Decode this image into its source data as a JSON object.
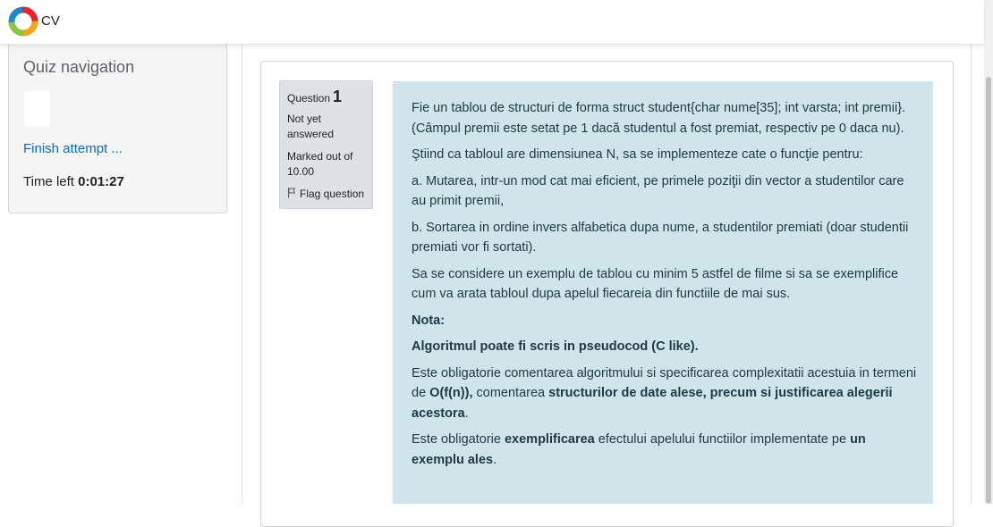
{
  "navbar": {
    "brand": "CV",
    "logo_icon": "ring-logo-icon"
  },
  "quiz_navigation": {
    "title": "Quiz navigation",
    "finish_label": "Finish attempt ...",
    "time_left_label": "Time left",
    "time_left_value": "0:01:27"
  },
  "question": {
    "label": "Question",
    "number": "1",
    "state": "Not yet answered",
    "grade": "Marked out of 10.00",
    "flag_label": "Flag question"
  },
  "question_text": {
    "p1": "Fie un tablou de structuri de forma struct student{char nume[35]; int varsta; int premii}. (Câmpul premii este setat pe 1 dacă studentul a fost premiat, respectiv pe 0 daca nu).",
    "p2": "Ştiind ca tabloul are dimensiunea N, sa se implementeze cate o funcţie pentru:",
    "p3": "a. Mutarea, intr-un mod cat mai eficient, pe primele poziţii din vector a studentilor care au primit premii,",
    "p4": "b. Sortarea in ordine invers alfabetica dupa nume, a studentilor premiati (doar studentii premiati vor fi sortati).",
    "p5": "Sa se considere un exemplu de tablou cu minim 5 astfel de filme si sa se exemplifice cum va arata tabloul dupa apelul fiecareia din functiile de mai sus.",
    "nota": "Nota:",
    "algo": "Algoritmul poate fi scris in pseudocod (C like).",
    "p8_a": "Este obligatorie comentarea algoritmului si specificarea complexitatii acestuia in termeni de ",
    "p8_b": "O(f(n)),",
    "p8_c": " comentarea ",
    "p8_d": "structurilor de date alese, precum si justificarea alegerii acestora",
    "p8_e": ".",
    "p9_a": "Este obligatorie ",
    "p9_b": "exemplificarea",
    "p9_c": " efectului apelului functiilor implementate pe ",
    "p9_d": "un exemplu ales",
    "p9_e": "."
  },
  "colors": {
    "link": "#0f6cbf",
    "content_bg": "#cfe5e9",
    "info_bg": "#dee2e6",
    "nav_bg": "#f5f5f5"
  }
}
